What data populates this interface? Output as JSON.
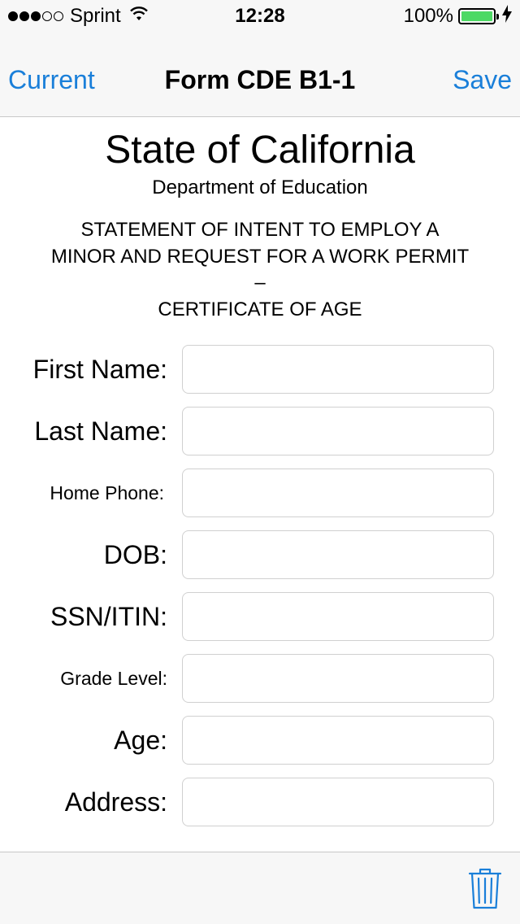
{
  "status_bar": {
    "carrier": "Sprint",
    "time": "12:28",
    "battery_percent": "100%",
    "battery_level": 1.0,
    "signal_bars_filled": 3,
    "signal_bars_total": 5
  },
  "nav": {
    "left_label": "Current",
    "title": "Form CDE B1-1",
    "right_label": "Save"
  },
  "header": {
    "state": "State of California",
    "department": "Department of Education",
    "statement_line1": "STATEMENT OF INTENT TO EMPLOY A",
    "statement_line2": "MINOR AND REQUEST FOR A WORK PERMIT",
    "statement_line3": "–",
    "statement_line4": "CERTIFICATE OF AGE"
  },
  "form": {
    "first_name": {
      "label": "First Name:",
      "value": ""
    },
    "last_name": {
      "label": "Last Name:",
      "value": ""
    },
    "home_phone": {
      "label": "Home Phone:",
      "value": ""
    },
    "dob": {
      "label": "DOB:",
      "value": ""
    },
    "ssn": {
      "label": "SSN/ITIN:",
      "value": ""
    },
    "grade_level": {
      "label": "Grade Level:",
      "value": ""
    },
    "age": {
      "label": "Age:",
      "value": ""
    },
    "address": {
      "label": "Address:",
      "value": ""
    }
  },
  "colors": {
    "accent": "#1a7fd9",
    "battery": "#4cd964",
    "bar_background": "#f7f7f7"
  },
  "icons": {
    "toolbar_action": "trash-icon",
    "status_network": "wifi-icon",
    "status_charging": "bolt-icon"
  }
}
